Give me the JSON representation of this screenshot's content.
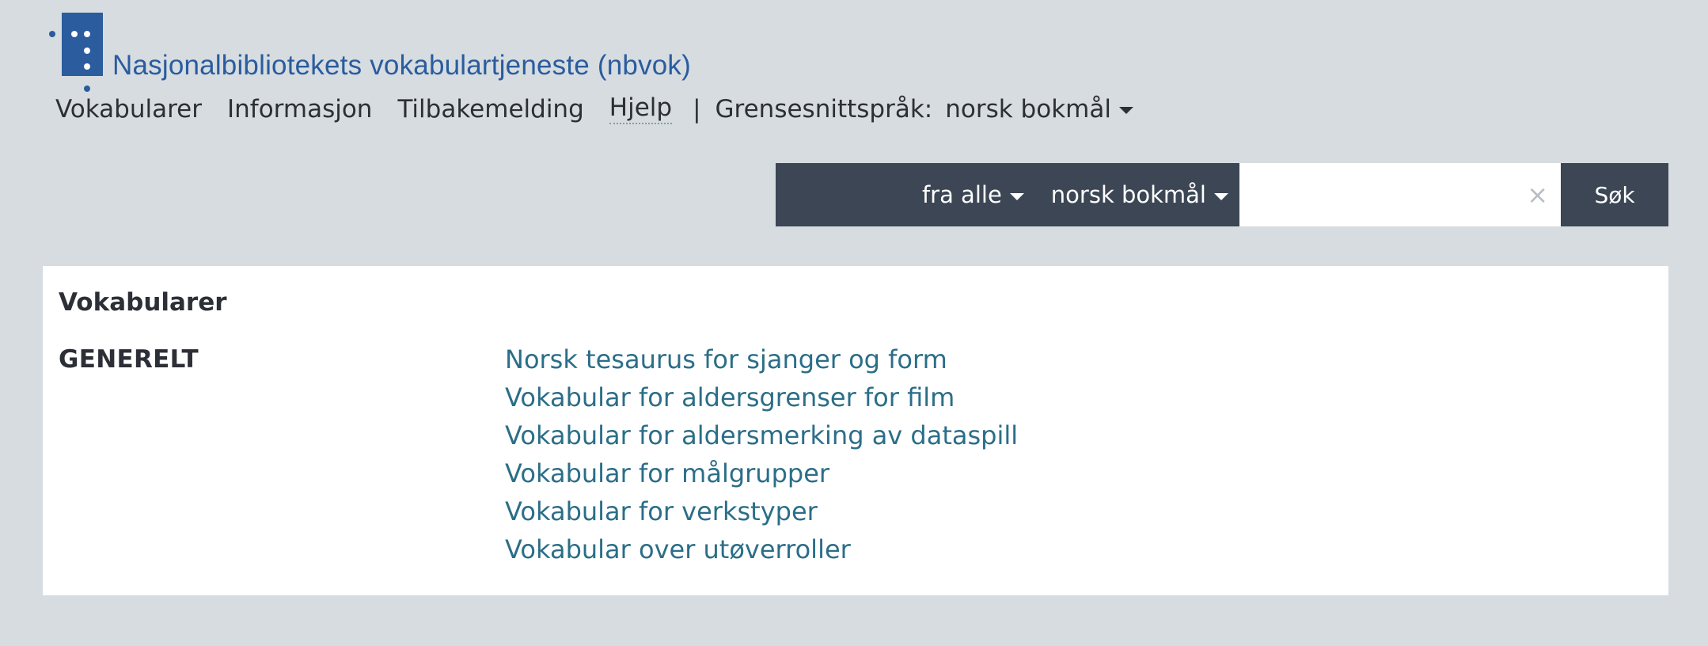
{
  "header": {
    "site_title": "Nasjonalbibliotekets vokabulartjeneste (nbvok)",
    "logo_icon": "nb-logo-icon"
  },
  "nav": {
    "items": [
      {
        "label": "Vokabularer"
      },
      {
        "label": "Informasjon"
      },
      {
        "label": "Tilbakemelding"
      },
      {
        "label": "Hjelp"
      }
    ],
    "separator": "|",
    "language_label": "Grensesnittspråk:",
    "language_value": "norsk bokmål"
  },
  "search": {
    "scope_value": "fra alle",
    "language_value": "norsk bokmål",
    "query": "",
    "clear_icon": "×",
    "button_label": "Søk"
  },
  "main": {
    "title": "Vokabularer",
    "groups": [
      {
        "heading": "GENERELT",
        "vocabularies": [
          {
            "label": "Norsk tesaurus for sjanger og form"
          },
          {
            "label": "Vokabular for aldersgrenser for film"
          },
          {
            "label": "Vokabular for aldersmerking av dataspill"
          },
          {
            "label": "Vokabular for målgrupper"
          },
          {
            "label": "Vokabular for verkstyper"
          },
          {
            "label": "Vokabular over utøverroller"
          }
        ]
      }
    ]
  },
  "colors": {
    "page_background": "#d6dce0",
    "brand_blue": "#2a5c9e",
    "search_bar": "#3c4654",
    "link": "#2b6e88"
  }
}
